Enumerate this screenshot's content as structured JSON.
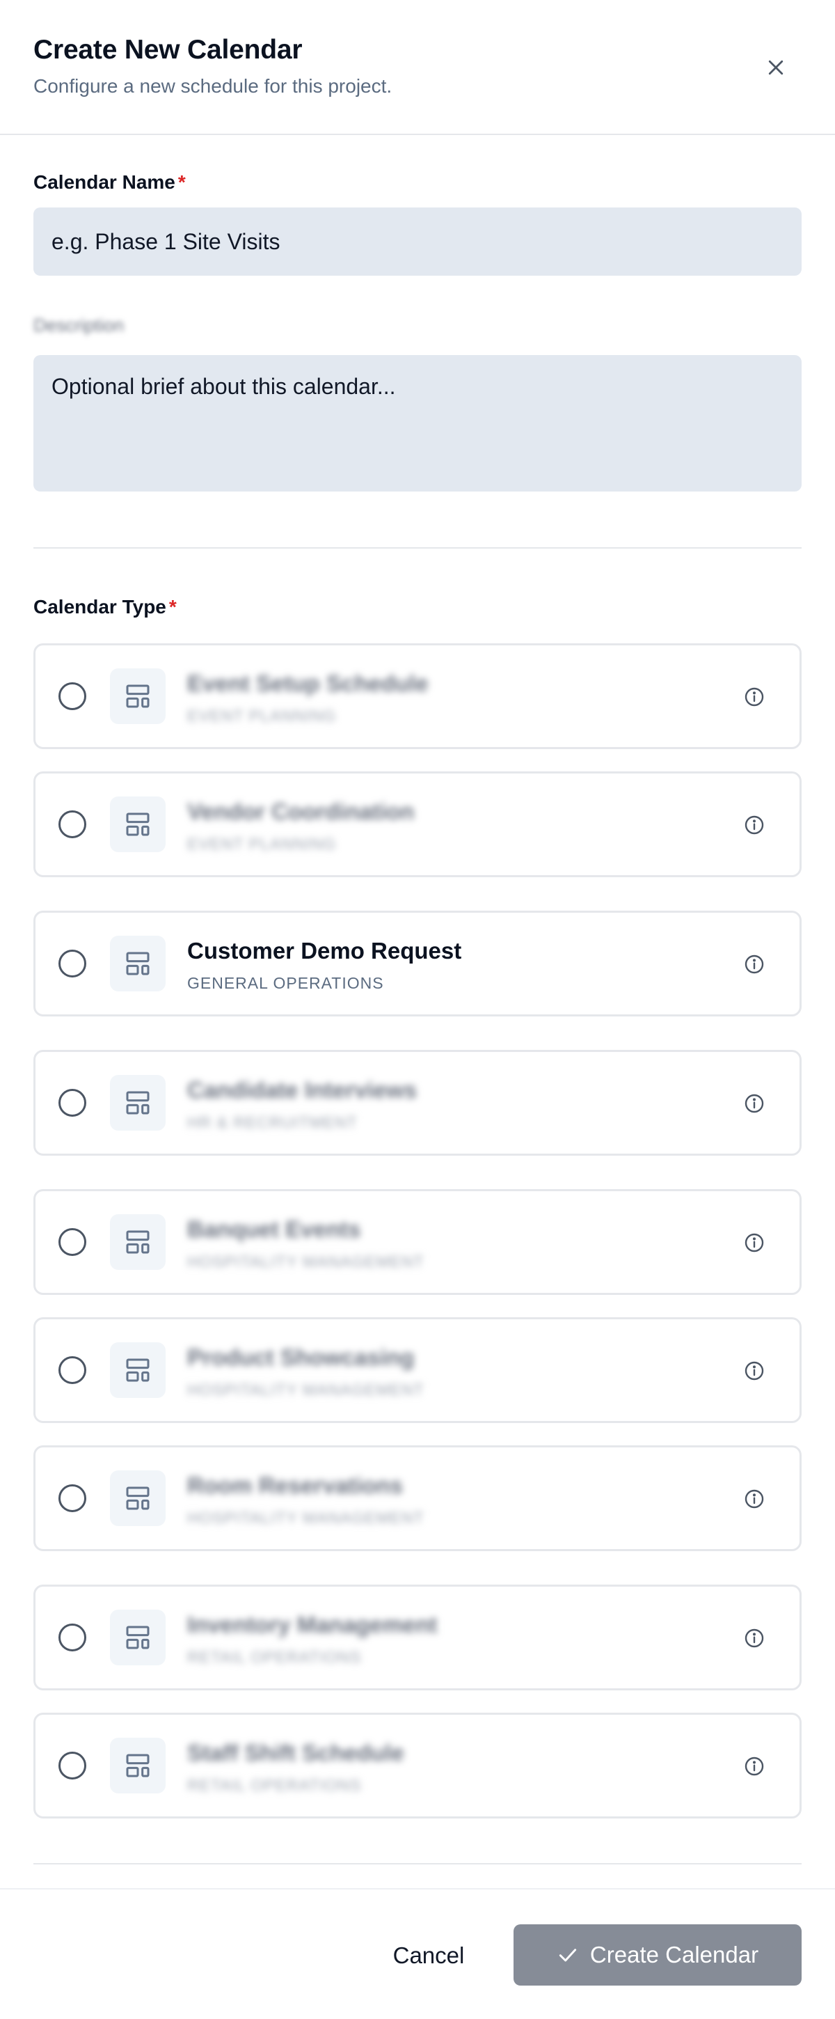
{
  "header": {
    "title": "Create New Calendar",
    "subtitle": "Configure a new schedule for this project."
  },
  "form": {
    "name_label": "Calendar Name",
    "required_mark": "*",
    "name_placeholder": "e.g. Phase 1 Site Visits",
    "description_label": "Description",
    "description_placeholder": "Optional brief about this calendar...",
    "type_label": "Calendar Type"
  },
  "calendar_types": [
    {
      "title": "Event Setup Schedule",
      "category": "EVENT PLANNING",
      "blurred": true
    },
    {
      "title": "Vendor Coordination",
      "category": "EVENT PLANNING",
      "blurred": true
    },
    {
      "title": "Customer Demo Request",
      "category": "GENERAL OPERATIONS",
      "blurred": false
    },
    {
      "title": "Candidate Interviews",
      "category": "HR & RECRUITMENT",
      "blurred": true
    },
    {
      "title": "Banquet Events",
      "category": "HOSPITALITY MANAGEMENT",
      "blurred": true
    },
    {
      "title": "Product Showcasing",
      "category": "HOSPITALITY MANAGEMENT",
      "blurred": true
    },
    {
      "title": "Room Reservations",
      "category": "HOSPITALITY MANAGEMENT",
      "blurred": true
    },
    {
      "title": "Inventory Management",
      "category": "RETAIL OPERATIONS",
      "blurred": true
    },
    {
      "title": "Staff Shift Schedule",
      "category": "RETAIL OPERATIONS",
      "blurred": true
    }
  ],
  "footer": {
    "cancel_label": "Cancel",
    "create_label": "Create Calendar"
  },
  "icons": {
    "close": "close-icon",
    "type": "layout-template-icon",
    "info": "info-icon",
    "create": "check-icon"
  },
  "colors": {
    "required": "#dc2626",
    "input_bg": "#e2e8f0",
    "create_button_bg": "#868c97"
  }
}
